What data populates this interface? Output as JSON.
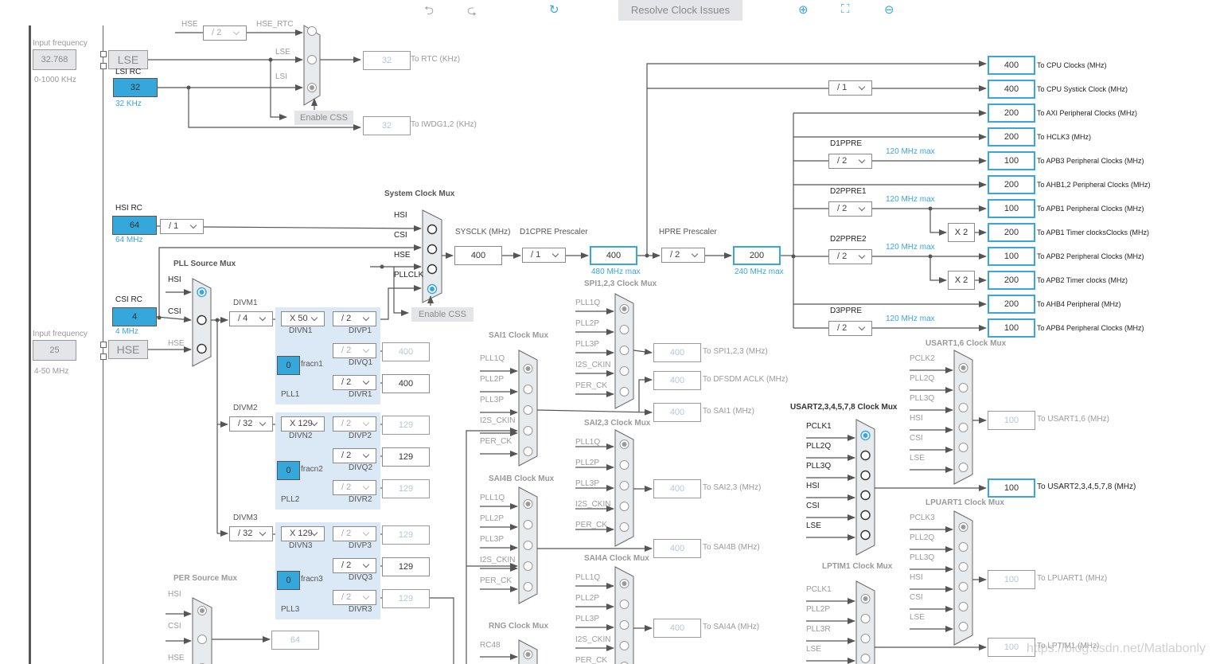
{
  "toolbar": {
    "resolve_label": "Resolve Clock Issues",
    "icons": [
      "undo-icon",
      "redo-icon",
      "refresh-icon",
      "zoom-in-icon",
      "fit-screen-icon",
      "zoom-out-icon"
    ]
  },
  "colors": {
    "accent": "#3aa6dd",
    "line": "#555555",
    "disabled": "#a0a0a0",
    "pll_bg": "#dbe8f5",
    "source_fill": "#36a7db"
  },
  "lse": {
    "input_label": "Input frequency",
    "input_value": "32.768",
    "range": "0-1000 KHz",
    "name": "LSE"
  },
  "lsi": {
    "label": "LSI RC",
    "value": "32",
    "freq": "32 KHz"
  },
  "rtc_mux": {
    "hse_label": "HSE",
    "divider": "/ 2",
    "hse_rtc_label": "HSE_RTC",
    "lse_label": "LSE",
    "lsi_label": "LSI",
    "selected": "LSI",
    "enable_css": "Enable CSS",
    "rtc_value": "32",
    "rtc_label": "To RTC (KHz)",
    "iwdg_value": "32",
    "iwdg_label": "To IWDG1,2 (KHz)"
  },
  "hsi": {
    "label": "HSI RC",
    "value": "64",
    "freq": "64 MHz",
    "divider": "/ 1"
  },
  "csi": {
    "label": "CSI RC",
    "value": "4",
    "freq": "4 MHz"
  },
  "hse": {
    "input_label": "Input frequency",
    "input_value": "25",
    "range": "4-50 MHz",
    "name": "HSE"
  },
  "pll_mux": {
    "title": "PLL Source Mux",
    "inputs": [
      "HSI",
      "CSI",
      "HSE"
    ],
    "selected": "HSI"
  },
  "plls": [
    {
      "name": "PLL1",
      "divm_label": "DIVM1",
      "divm": "/ 4",
      "divn_label": "DIVN1",
      "divn": "X 50",
      "frac": "0",
      "frac_label": "fracn1",
      "divp_label": "DIVP1",
      "divp": "/ 2",
      "divq_label": "DIVQ1",
      "divq": "/ 2",
      "q_out": "400",
      "divr_label": "DIVR1",
      "divr": "/ 2",
      "r_out": "400"
    },
    {
      "name": "PLL2",
      "divm_label": "DIVM2",
      "divm": "/ 32",
      "divn_label": "DIVN2",
      "divn": "X 129",
      "frac": "0",
      "frac_label": "fracn2",
      "divp_label": "DIVP2",
      "divp": "/ 2",
      "p_out": "129",
      "divq_label": "DIVQ2",
      "divq": "/ 2",
      "q_out": "129",
      "divr_label": "DIVR2",
      "divr": "/ 2",
      "r_out": "129"
    },
    {
      "name": "PLL3",
      "divm_label": "DIVM3",
      "divm": "/ 32",
      "divn_label": "DIVN3",
      "divn": "X 129",
      "frac": "0",
      "frac_label": "fracn3",
      "divp_label": "DIVP3",
      "divp": "/ 2",
      "p_out": "129",
      "divq_label": "DIVQ3",
      "divq": "/ 2",
      "q_out": "129",
      "divr_label": "DIVR3",
      "divr": "/ 2",
      "r_out": "129"
    }
  ],
  "system": {
    "title": "System Clock Mux",
    "inputs": [
      "HSI",
      "CSI",
      "HSE",
      "PLLCLK"
    ],
    "selected": "PLLCLK",
    "enable_css": "Enable CSS",
    "sysclk_label": "SYSCLK (MHz)",
    "sysclk": "400",
    "d1cpre_label": "D1CPRE Prescaler",
    "d1cpre": "/ 1",
    "cpu": "400",
    "cpu_max": "480 MHz max",
    "hpre_label": "HPRE Prescaler",
    "hpre": "/ 2",
    "hclk": "200",
    "hclk_max": "240 MHz max"
  },
  "bus": {
    "systick_div": "/ 1",
    "x2": "X 2",
    "prescalers": [
      {
        "label": "D1PPRE",
        "value": "/ 2",
        "max": "120 MHz max"
      },
      {
        "label": "D2PPRE1",
        "value": "/ 2",
        "max": "120 MHz max"
      },
      {
        "label": "D2PPRE2",
        "value": "/ 2",
        "max": "120 MHz max"
      },
      {
        "label": "D3PPRE",
        "value": "/ 2",
        "max": "120 MHz max"
      }
    ],
    "outputs": [
      {
        "value": "400",
        "label": "To CPU Clocks (MHz)"
      },
      {
        "value": "400",
        "label": "To CPU Systick Clock (MHz)"
      },
      {
        "value": "200",
        "label": "To AXI Peripheral Clocks (MHz)"
      },
      {
        "value": "200",
        "label": "To HCLK3 (MHz)"
      },
      {
        "value": "100",
        "label": "To APB3 Peripheral Clocks (MHz)"
      },
      {
        "value": "200",
        "label": "To AHB1,2 Peripheral Clocks (MHz)"
      },
      {
        "value": "100",
        "label": "To APB1 Peripheral Clocks (MHz)"
      },
      {
        "value": "200",
        "label": "To APB1 Timer clocksClocks (MHz)"
      },
      {
        "value": "100",
        "label": "To APB2 Peripheral Clocks (MHz)"
      },
      {
        "value": "200",
        "label": "To APB2 Timer clocks (MHz)"
      },
      {
        "value": "200",
        "label": "To AHB4 Peripheral (MHz)"
      },
      {
        "value": "100",
        "label": "To APB4 Peripheral Clocks (MHz)"
      }
    ]
  },
  "per_mux": {
    "title": "PER Source Mux",
    "inputs": [
      "HSI",
      "CSI",
      "HSE"
    ],
    "selected": "HSI",
    "value": "64"
  },
  "periph_muxes": {
    "spi123": {
      "title": "SPI1,2,3 Clock Mux",
      "inputs": [
        "PLL1Q",
        "PLL2P",
        "PLL3P",
        "I2S_CKIN",
        "PER_CK"
      ],
      "selected": "PLL1Q",
      "value": "400",
      "output_label": "To SPI1,2,3 (MHz)"
    },
    "sai1": {
      "title": "SAI1 Clock Mux",
      "inputs": [
        "PLL1Q",
        "PLL2P",
        "PLL3P",
        "I2S_CKIN",
        "PER_CK"
      ],
      "selected": "PLL1Q",
      "value": "400",
      "output_label": "To SAI1 (MHz)",
      "dfsdm_value": "400",
      "dfsdm_label": "To DFSDM ACLK (MHz)"
    },
    "sai23": {
      "title": "SAI2,3 Clock Mux",
      "inputs": [
        "PLL1Q",
        "PLL2P",
        "PLL3P",
        "I2S_CKIN",
        "PER_CK"
      ],
      "selected": "PLL1Q",
      "value": "400",
      "output_label": "To SAI2,3 (MHz)"
    },
    "sai4b": {
      "title": "SAI4B Clock Mux",
      "inputs": [
        "PLL1Q",
        "PLL2P",
        "PLL3P",
        "I2S_CKIN",
        "PER_CK"
      ],
      "selected": "PLL1Q",
      "value": "400",
      "output_label": "To SAI4B (MHz)"
    },
    "sai4a": {
      "title": "SAI4A Clock Mux",
      "inputs": [
        "PLL1Q",
        "PLL2P",
        "PLL3P",
        "I2S_CKIN",
        "PER_CK"
      ],
      "selected": "PLL1Q",
      "value": "400",
      "output_label": "To SAI4A (MHz)"
    },
    "rng": {
      "title": "RNG Clock Mux",
      "inputs": [
        "RC48"
      ],
      "selected": "RC48"
    },
    "usart16": {
      "title": "USART1,6 Clock Mux",
      "inputs": [
        "PCLK2",
        "PLL2Q",
        "PLL3Q",
        "HSI",
        "CSI",
        "LSE"
      ],
      "selected": "PCLK2",
      "value": "100",
      "output_label": "To USART1,6 (MHz)"
    },
    "usart234578": {
      "title": "USART2,3,4,5,7,8 Clock Mux",
      "inputs": [
        "PCLK1",
        "PLL2Q",
        "PLL3Q",
        "HSI",
        "CSI",
        "LSE"
      ],
      "selected": "PCLK1",
      "value": "100",
      "output_label": "To USART2,3,4,5,7,8 (MHz)"
    },
    "lpuart1": {
      "title": "LPUART1 Clock Mux",
      "inputs": [
        "PCLK3",
        "PLL2Q",
        "PLL3Q",
        "HSI",
        "CSI",
        "LSE"
      ],
      "selected": "PCLK3",
      "value": "100",
      "output_label": "To LPUART1 (MHz)"
    },
    "lptim1": {
      "title": "LPTIM1 Clock Mux",
      "inputs": [
        "PCLK1",
        "PLL2P",
        "PLL3R",
        "LSE"
      ],
      "selected": "PCLK1",
      "value": "100",
      "output_label": "To LPTIM1 (MHz)"
    }
  },
  "watermark": "https://blog.csdn.net/Matlabonly"
}
